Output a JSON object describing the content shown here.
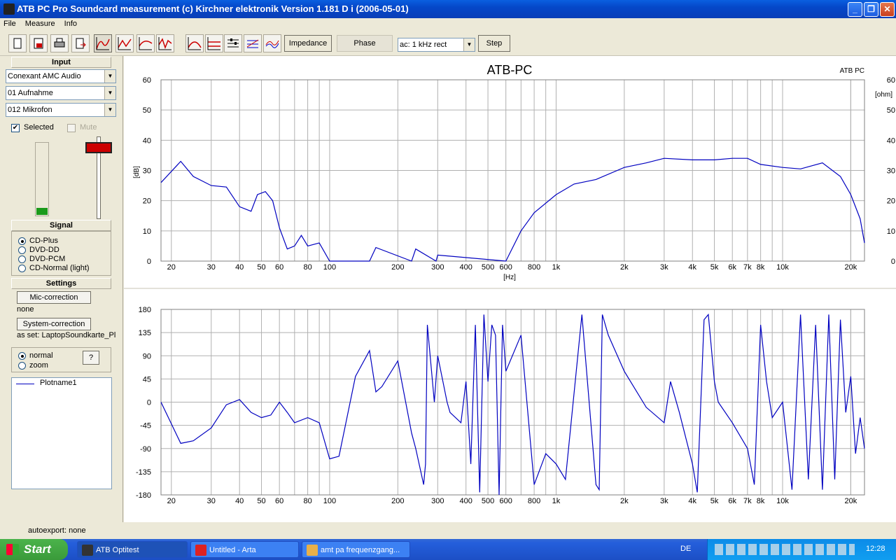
{
  "window": {
    "title": "ATB PC Pro Soundcard measurement (c) Kirchner elektronik    Version 1.181 D i  (2006-05-01)"
  },
  "menu": [
    "File",
    "Measure",
    "Info"
  ],
  "toolbar": {
    "icons": [
      "new-icon",
      "save-icon",
      "print-icon",
      "export-icon",
      "measure-m-icon",
      "measure-mt-icon",
      "measure-mh-icon",
      "measure-ms-icon",
      "measure-mf-icon",
      "measure-mr-icon",
      "settings-icon",
      "grid-icon",
      "compare-icon"
    ],
    "impedance_label": "Impedance",
    "phase_label": "Phase",
    "signal_value": "ac:  1 kHz rect",
    "step_label": "Step"
  },
  "left": {
    "input_header": "Input",
    "device": "Conexant AMC Audio",
    "channel": "01 Aufnahme",
    "source": "012 Mikrofon",
    "selected_label": "Selected",
    "mute_label": "Mute",
    "level_fraction": 0.1,
    "signal_header": "Signal",
    "signal_options": [
      "CD-Plus",
      "DVD-DD",
      "DVD-PCM",
      "CD-Normal  (light)"
    ],
    "settings_header": "Settings",
    "mic_correction_label": "Mic-correction",
    "mic_correction_value": "none",
    "system_correction_label": "System-correction",
    "system_correction_value": "as set: LaptopSoundkarte_Pl",
    "view_options": [
      "normal",
      "zoom"
    ],
    "help_label": "?",
    "legend": "Plotname1"
  },
  "chart_data": [
    {
      "type": "line",
      "title": "ATB-PC",
      "corner_label": "ATB PC",
      "ylabel": "[dB]",
      "xlabel": "[Hz]",
      "right_label": "[ohm]",
      "xscale": "log",
      "xlim": [
        18,
        23000
      ],
      "ylim": [
        0,
        60
      ],
      "yticks": [
        0,
        10,
        20,
        30,
        40,
        50,
        60
      ],
      "xticks": [
        "20",
        "30",
        "40",
        "50",
        "60",
        "80",
        "100",
        "200",
        "300",
        "400",
        "500",
        "600",
        "800",
        "1k",
        "2k",
        "3k",
        "4k",
        "5k",
        "6k",
        "7k",
        "8k",
        "10k",
        "20k"
      ],
      "grid": true,
      "color": "#0000c0",
      "series": [
        {
          "name": "Plotname1",
          "x": [
            18,
            22,
            25,
            30,
            35,
            40,
            45,
            48,
            52,
            56,
            60,
            65,
            70,
            75,
            80,
            90,
            100,
            150,
            160,
            230,
            240,
            295,
            300,
            600,
            700,
            800,
            1000,
            1200,
            1500,
            2000,
            2500,
            3000,
            4000,
            5000,
            6000,
            7000,
            8000,
            10000,
            12000,
            15000,
            18000,
            20000,
            22000,
            23000
          ],
          "y": [
            26,
            33,
            28,
            25,
            24.5,
            18,
            16.5,
            22,
            23,
            20,
            11,
            4,
            5,
            8.5,
            5,
            6,
            0,
            0,
            4.5,
            0,
            4,
            0,
            2,
            0,
            10,
            16,
            22,
            25.5,
            27,
            31,
            32.5,
            34,
            33.5,
            33.5,
            34,
            34,
            32,
            31,
            30.5,
            32.5,
            28,
            22,
            14,
            6
          ]
        }
      ]
    },
    {
      "type": "line",
      "ylabel": "",
      "xscale": "log",
      "xlim": [
        18,
        23000
      ],
      "ylim": [
        -180,
        180
      ],
      "yticks": [
        -180,
        -135,
        -90,
        -45,
        0,
        45,
        90,
        135,
        180
      ],
      "xticks": [
        "20",
        "30",
        "40",
        "50",
        "60",
        "80",
        "100",
        "200",
        "300",
        "400",
        "500",
        "600",
        "800",
        "1k",
        "2k",
        "3k",
        "4k",
        "5k",
        "6k",
        "7k",
        "8k",
        "10k",
        "20k"
      ],
      "grid": true,
      "color": "#0000c0",
      "series": [
        {
          "name": "Plotname1",
          "x": [
            18,
            22,
            25,
            30,
            35,
            40,
            45,
            50,
            55,
            60,
            65,
            70,
            80,
            90,
            100,
            110,
            130,
            150,
            160,
            170,
            200,
            230,
            240,
            260,
            265,
            270,
            290,
            300,
            330,
            340,
            380,
            400,
            420,
            440,
            460,
            480,
            500,
            520,
            540,
            560,
            580,
            600,
            700,
            800,
            900,
            1000,
            1100,
            1300,
            1500,
            1550,
            1600,
            1700,
            2000,
            2500,
            3000,
            3200,
            3500,
            4000,
            4200,
            4500,
            4700,
            5000,
            5200,
            6000,
            7000,
            7500,
            8000,
            8500,
            9000,
            10000,
            11000,
            12000,
            13000,
            14000,
            15000,
            16000,
            17000,
            18000,
            19000,
            20000,
            21000,
            22000,
            23000
          ],
          "y": [
            0,
            -80,
            -75,
            -50,
            -5,
            5,
            -20,
            -30,
            -25,
            0,
            -20,
            -40,
            -30,
            -40,
            -110,
            -105,
            50,
            100,
            20,
            30,
            80,
            -60,
            -90,
            -160,
            -120,
            150,
            0,
            90,
            0,
            -20,
            -40,
            40,
            -120,
            150,
            -175,
            170,
            40,
            150,
            130,
            -180,
            150,
            60,
            130,
            -160,
            -100,
            -120,
            -150,
            170,
            -160,
            -170,
            170,
            130,
            60,
            -10,
            -40,
            40,
            -20,
            -120,
            -175,
            160,
            170,
            40,
            0,
            -40,
            -90,
            -160,
            150,
            40,
            -30,
            0,
            -170,
            170,
            -150,
            150,
            -170,
            170,
            -150,
            160,
            -20,
            50,
            -100,
            -30,
            -90
          ]
        }
      ]
    }
  ],
  "status": {
    "text": "autoexport: none"
  },
  "taskbar": {
    "start": "Start",
    "tasks": [
      "ATB Optitest",
      "Untitled - Arta",
      "amt pa frequenzgang..."
    ],
    "lang": "DE",
    "clock": "12:28"
  }
}
